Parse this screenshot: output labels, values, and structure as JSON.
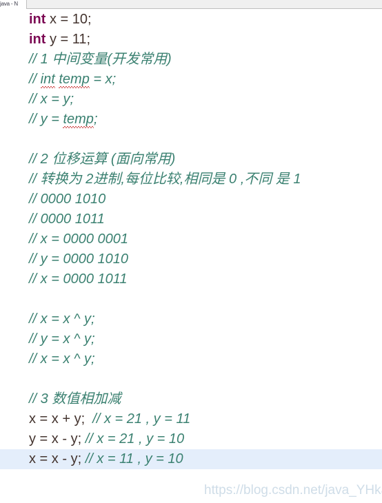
{
  "window": {
    "tab_sliver_label": "java - N",
    "toolbar_label": ""
  },
  "editor": {
    "background": "#ffffff",
    "current_line_highlight": "#e4eefb",
    "colors": {
      "keyword": "#7c0a54",
      "identifier": "#44342f",
      "comment": "#3b8171",
      "spellcheck_underline": "#d05050"
    },
    "lines": [
      {
        "index": 1,
        "current": false,
        "text": "int x = 10;",
        "tokens": [
          {
            "t": "int",
            "k": "kw"
          },
          {
            "t": " x = 10;",
            "k": "id"
          }
        ]
      },
      {
        "index": 2,
        "current": false,
        "text": "int y = 11;",
        "tokens": [
          {
            "t": "int",
            "k": "kw"
          },
          {
            "t": " y = 11;",
            "k": "id"
          }
        ]
      },
      {
        "index": 3,
        "current": false,
        "text": "// 1 中间变量(开发常用)",
        "tokens": [
          {
            "t": "// 1 中间变量(开发常用)",
            "k": "comment"
          }
        ]
      },
      {
        "index": 4,
        "current": false,
        "text": "// int temp = x;",
        "tokens": [
          {
            "t": "// ",
            "k": "comment"
          },
          {
            "t": "int",
            "k": "comment-spell"
          },
          {
            "t": " ",
            "k": "comment"
          },
          {
            "t": "temp",
            "k": "comment-spell"
          },
          {
            "t": " = x;",
            "k": "comment"
          }
        ]
      },
      {
        "index": 5,
        "current": false,
        "text": "// x = y;",
        "tokens": [
          {
            "t": "// x = y;",
            "k": "comment"
          }
        ]
      },
      {
        "index": 6,
        "current": false,
        "text": "// y = temp;",
        "tokens": [
          {
            "t": "// y = ",
            "k": "comment"
          },
          {
            "t": "temp",
            "k": "comment-spell"
          },
          {
            "t": ";",
            "k": "comment"
          }
        ]
      },
      {
        "index": 7,
        "current": false,
        "text": "",
        "tokens": []
      },
      {
        "index": 8,
        "current": false,
        "text": "// 2 位移运算 (面向常用)",
        "tokens": [
          {
            "t": "// 2 位移运算 (面向常用)",
            "k": "comment"
          }
        ]
      },
      {
        "index": 9,
        "current": false,
        "text": "// 转换为 2进制,每位比较,相同是 0 ,不同 是 1",
        "tokens": [
          {
            "t": "// 转换为 2进制,每位比较,相同是 0 ,不同 是 1",
            "k": "comment"
          }
        ]
      },
      {
        "index": 10,
        "current": false,
        "text": "// 0000 1010",
        "tokens": [
          {
            "t": "// 0000 1010",
            "k": "comment"
          }
        ]
      },
      {
        "index": 11,
        "current": false,
        "text": "// 0000 1011",
        "tokens": [
          {
            "t": "// 0000 1011",
            "k": "comment"
          }
        ]
      },
      {
        "index": 12,
        "current": false,
        "text": "// x = 0000 0001",
        "tokens": [
          {
            "t": "// x = 0000 0001",
            "k": "comment"
          }
        ]
      },
      {
        "index": 13,
        "current": false,
        "text": "// y = 0000 1010",
        "tokens": [
          {
            "t": "// y = 0000 1010",
            "k": "comment"
          }
        ]
      },
      {
        "index": 14,
        "current": false,
        "text": "// x = 0000 1011",
        "tokens": [
          {
            "t": "// x = 0000 1011",
            "k": "comment"
          }
        ]
      },
      {
        "index": 15,
        "current": false,
        "text": "",
        "tokens": []
      },
      {
        "index": 16,
        "current": false,
        "text": "// x = x ^ y;",
        "tokens": [
          {
            "t": "// x = x ^ y;",
            "k": "comment"
          }
        ]
      },
      {
        "index": 17,
        "current": false,
        "text": "// y = x ^ y;",
        "tokens": [
          {
            "t": "// y = x ^ y;",
            "k": "comment"
          }
        ]
      },
      {
        "index": 18,
        "current": false,
        "text": "// x = x ^ y;",
        "tokens": [
          {
            "t": "// x = x ^ y;",
            "k": "comment"
          }
        ]
      },
      {
        "index": 19,
        "current": false,
        "text": "",
        "tokens": []
      },
      {
        "index": 20,
        "current": false,
        "text": "// 3 数值相加减",
        "tokens": [
          {
            "t": "// 3 数值相加减",
            "k": "comment"
          }
        ]
      },
      {
        "index": 21,
        "current": false,
        "text": "x = x + y;  // x = 21 , y = 11",
        "tokens": [
          {
            "t": "x = x + y;",
            "k": "id"
          },
          {
            "t": "  ",
            "k": "id"
          },
          {
            "t": "// x = 21 , y = 11",
            "k": "comment"
          }
        ]
      },
      {
        "index": 22,
        "current": false,
        "text": "y = x - y; // x = 21 , y = 10",
        "tokens": [
          {
            "t": "y = x - y;",
            "k": "id"
          },
          {
            "t": " ",
            "k": "id"
          },
          {
            "t": "// x = 21 , y = 10",
            "k": "comment"
          }
        ]
      },
      {
        "index": 23,
        "current": true,
        "text": "x = x - y; // x = 11 , y = 10",
        "tokens": [
          {
            "t": "x = x - y;",
            "k": "id"
          },
          {
            "t": " ",
            "k": "id"
          },
          {
            "t": "// x = 11 , y = 10",
            "k": "comment"
          }
        ]
      }
    ]
  },
  "watermark": {
    "text": "https://blog.csdn.net/java_YHkaifa",
    "color": "#cfdde8"
  }
}
